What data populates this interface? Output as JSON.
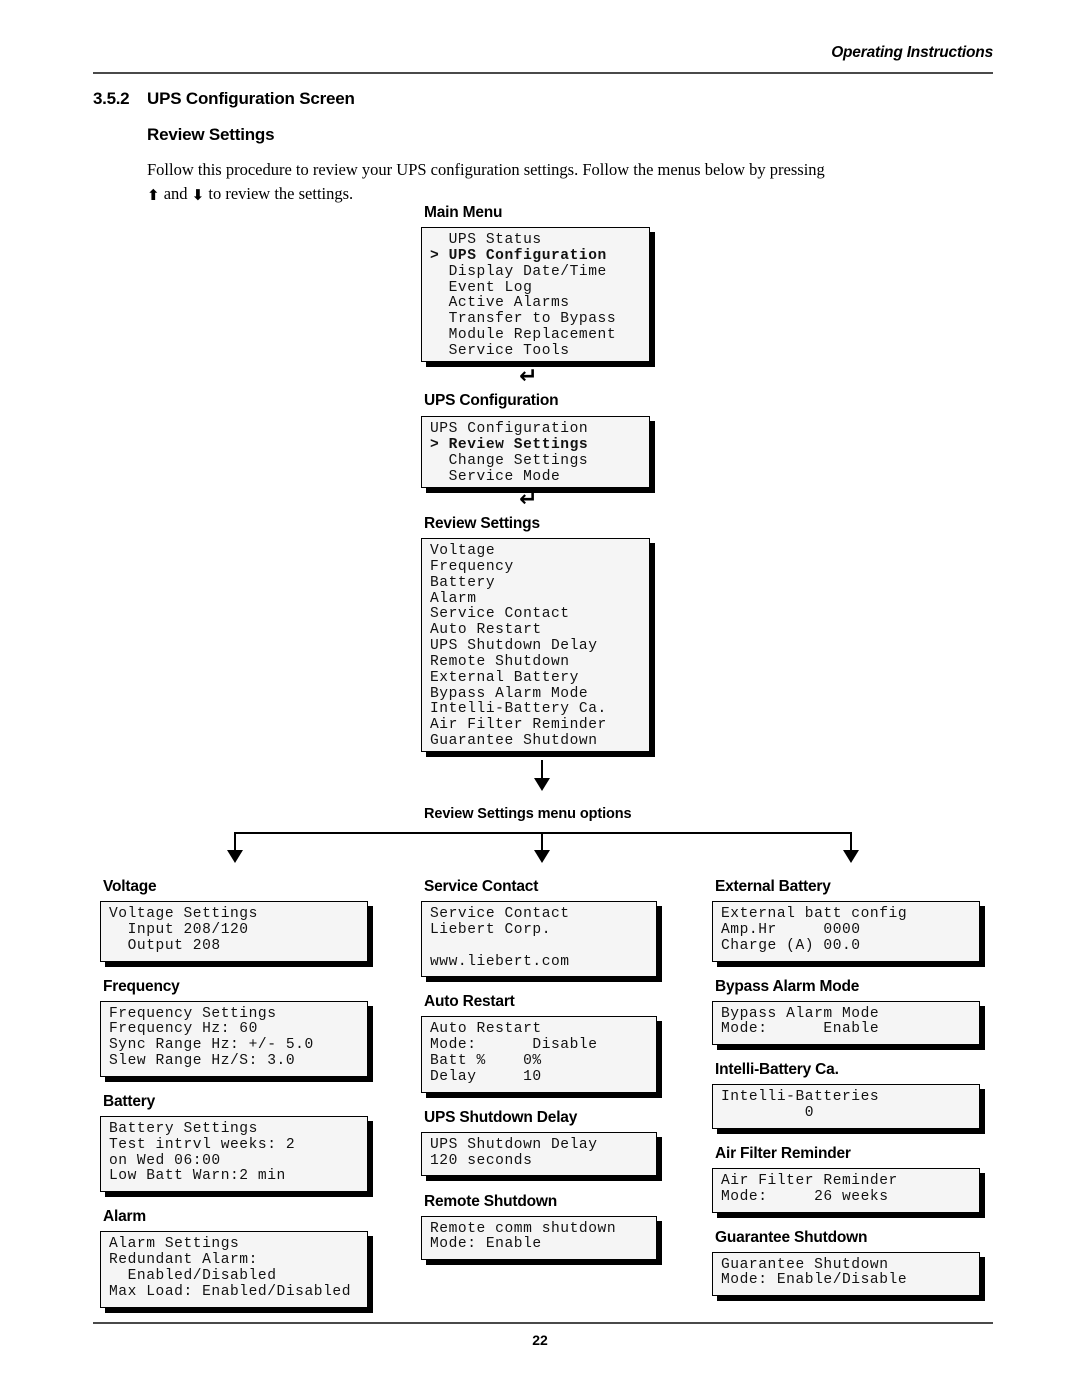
{
  "header": {
    "running_head": "Operating Instructions",
    "page_number": "22"
  },
  "section": {
    "number": "3.5.2",
    "title": "UPS Configuration Screen",
    "subtitle": "Review Settings",
    "paragraph_part1": "Follow this procedure to review your UPS configuration settings. Follow the menus below by pressing",
    "up_arrow": "⬆",
    "and_text": " and ",
    "down_arrow": "⬇",
    "paragraph_part2": " to review the settings."
  },
  "connectors": {
    "enter_glyph": "↵",
    "branch_caption": "Review Settings menu options"
  },
  "flow": {
    "main_menu": {
      "label": "Main Menu",
      "lines": [
        {
          "text": "  UPS Status",
          "selected": false
        },
        {
          "text": "> UPS Configuration",
          "selected": true
        },
        {
          "text": "  Display Date/Time",
          "selected": false
        },
        {
          "text": "  Event Log",
          "selected": false
        },
        {
          "text": "  Active Alarms",
          "selected": false
        },
        {
          "text": "  Transfer to Bypass",
          "selected": false
        },
        {
          "text": "  Module Replacement",
          "selected": false
        },
        {
          "text": "  Service Tools",
          "selected": false
        }
      ]
    },
    "ups_configuration": {
      "label": "UPS Configuration",
      "lines": [
        {
          "text": "UPS Configuration",
          "selected": false
        },
        {
          "text": "> Review Settings",
          "selected": true
        },
        {
          "text": "  Change Settings",
          "selected": false
        },
        {
          "text": "  Service Mode",
          "selected": false
        }
      ]
    },
    "review_settings": {
      "label": "Review Settings",
      "lines": [
        {
          "text": "Voltage",
          "selected": false
        },
        {
          "text": "Frequency",
          "selected": false
        },
        {
          "text": "Battery",
          "selected": false
        },
        {
          "text": "Alarm",
          "selected": false
        },
        {
          "text": "Service Contact",
          "selected": false
        },
        {
          "text": "Auto Restart",
          "selected": false
        },
        {
          "text": "UPS Shutdown Delay",
          "selected": false
        },
        {
          "text": "Remote Shutdown",
          "selected": false
        },
        {
          "text": "External Battery",
          "selected": false
        },
        {
          "text": "Bypass Alarm Mode",
          "selected": false
        },
        {
          "text": "Intelli-Battery Ca.",
          "selected": false
        },
        {
          "text": "Air Filter Reminder",
          "selected": false
        },
        {
          "text": "Guarantee Shutdown",
          "selected": false
        }
      ]
    }
  },
  "options": {
    "column_left": [
      {
        "label": "Voltage",
        "lines": [
          "Voltage Settings",
          "  Input 208/120",
          "  Output 208"
        ]
      },
      {
        "label": "Frequency",
        "lines": [
          "Frequency Settings",
          "Frequency Hz: 60",
          "Sync Range Hz: +/- 5.0",
          "Slew Range Hz/S: 3.0"
        ]
      },
      {
        "label": "Battery",
        "lines": [
          "Battery Settings",
          "Test intrvl weeks: 2",
          "on Wed 06:00",
          "Low Batt Warn:2 min"
        ]
      },
      {
        "label": "Alarm",
        "lines": [
          "Alarm Settings",
          "Redundant Alarm:",
          "  Enabled/Disabled",
          "Max Load: Enabled/Disabled"
        ]
      }
    ],
    "column_center": [
      {
        "label": "Service Contact",
        "lines": [
          "Service Contact",
          "Liebert Corp.",
          "",
          "www.liebert.com"
        ]
      },
      {
        "label": "Auto Restart",
        "lines": [
          "Auto Restart",
          "Mode:      Disable",
          "Batt %    0%",
          "Delay     10"
        ]
      },
      {
        "label": "UPS Shutdown Delay",
        "lines": [
          "UPS Shutdown Delay",
          "120 seconds"
        ]
      },
      {
        "label": "Remote Shutdown",
        "lines": [
          "Remote comm shutdown",
          "Mode: Enable"
        ]
      }
    ],
    "column_right": [
      {
        "label": "External Battery",
        "lines": [
          "External batt config",
          "Amp.Hr     0000",
          "Charge (A) 00.0"
        ]
      },
      {
        "label": "Bypass Alarm Mode",
        "lines": [
          "Bypass Alarm Mode",
          "Mode:      Enable"
        ]
      },
      {
        "label": "Intelli-Battery Ca.",
        "lines": [
          "Intelli-Batteries",
          "         0"
        ]
      },
      {
        "label": "Air Filter Reminder",
        "lines": [
          "Air Filter Reminder",
          "Mode:     26 weeks"
        ]
      },
      {
        "label": "Guarantee Shutdown",
        "lines": [
          "Guarantee Shutdown",
          "Mode: Enable/Disable"
        ]
      }
    ]
  }
}
